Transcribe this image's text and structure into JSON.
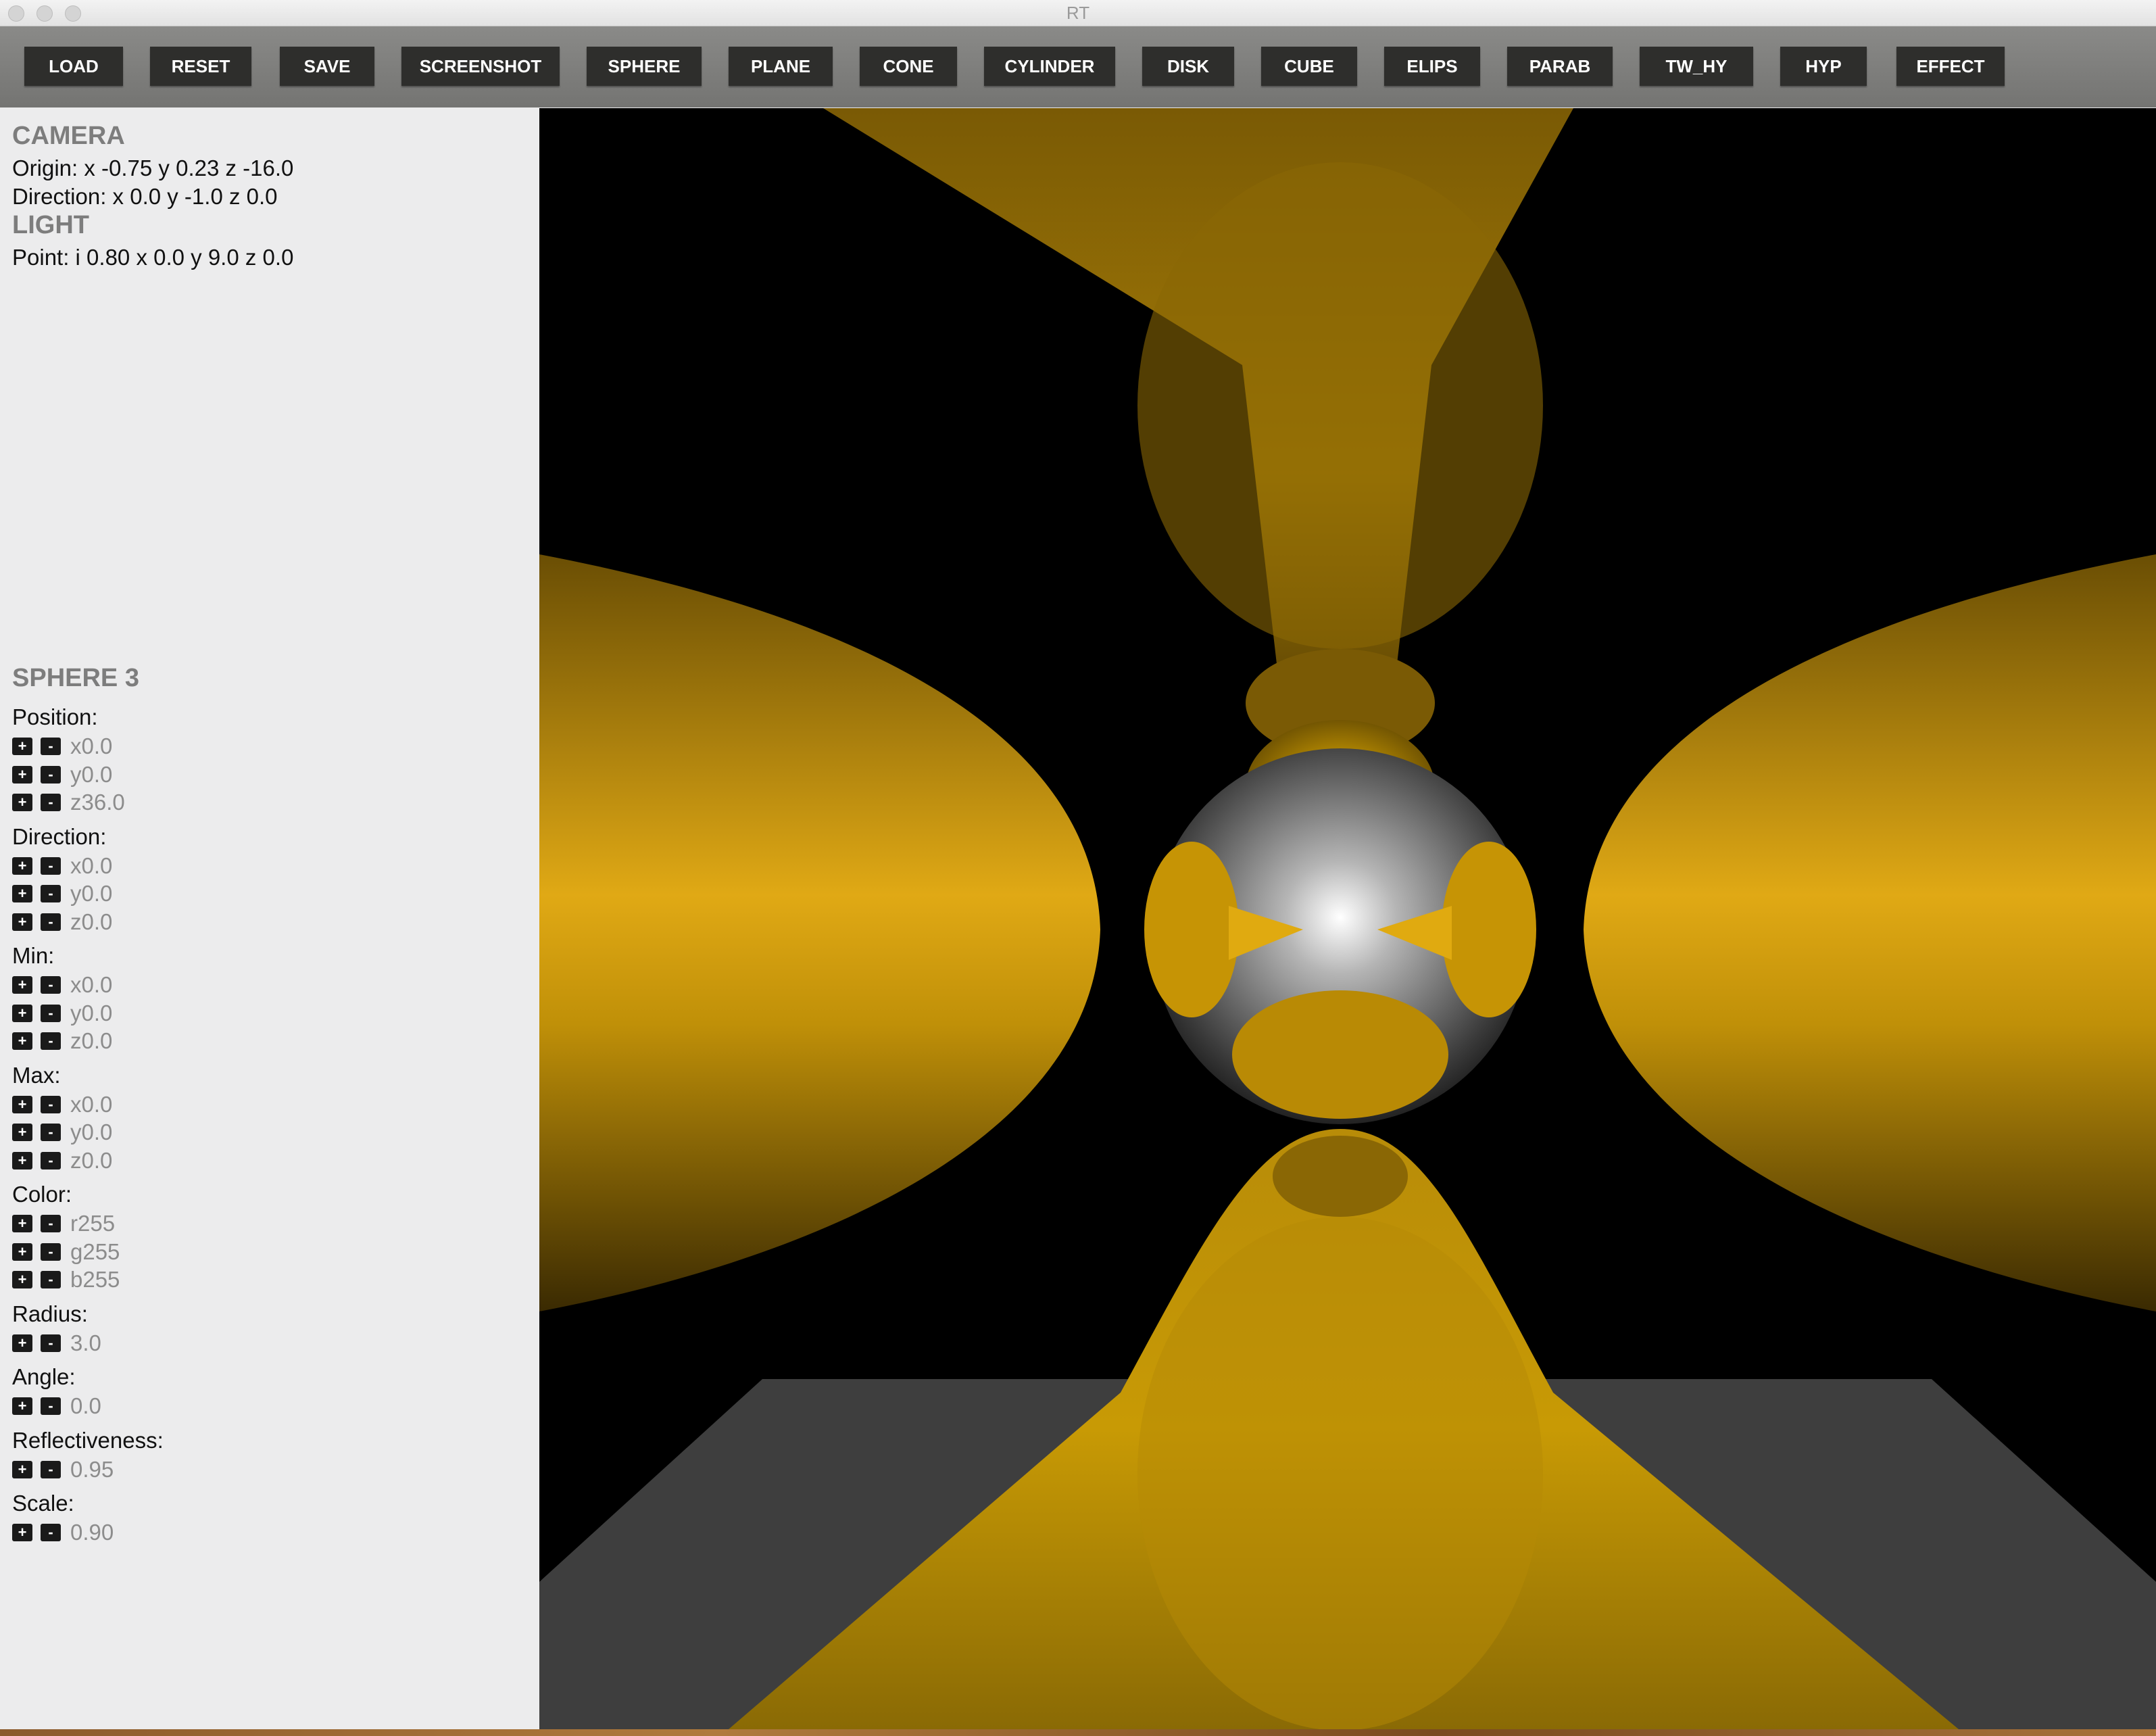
{
  "window": {
    "title": "RT"
  },
  "toolbar": {
    "buttons": [
      {
        "label": "LOAD"
      },
      {
        "label": "RESET"
      },
      {
        "label": "SAVE"
      },
      {
        "label": "SCREENSHOT"
      },
      {
        "label": "SPHERE"
      },
      {
        "label": "PLANE"
      },
      {
        "label": "CONE"
      },
      {
        "label": "CYLINDER"
      },
      {
        "label": "DISK"
      },
      {
        "label": "CUBE"
      },
      {
        "label": "ELIPS"
      },
      {
        "label": "PARAB"
      },
      {
        "label": "TW_HY"
      },
      {
        "label": "HYP"
      },
      {
        "label": "EFFECT"
      }
    ]
  },
  "camera": {
    "heading": "CAMERA",
    "origin": "Origin: x -0.75 y 0.23 z -16.0",
    "direction": "Direction: x 0.0 y -1.0 z 0.0"
  },
  "light": {
    "heading": "LIGHT",
    "point": "Point: i 0.80 x 0.0 y 9.0 z 0.0"
  },
  "object": {
    "heading": "SPHERE 3",
    "plus": "+",
    "minus": "-",
    "groups": [
      {
        "label": "Position:",
        "values": [
          "x0.0",
          "y0.0",
          "z36.0"
        ]
      },
      {
        "label": "Direction:",
        "values": [
          "x0.0",
          "y0.0",
          "z0.0"
        ]
      },
      {
        "label": "Min:",
        "values": [
          "x0.0",
          "y0.0",
          "z0.0"
        ]
      },
      {
        "label": "Max:",
        "values": [
          "x0.0",
          "y0.0",
          "z0.0"
        ]
      },
      {
        "label": "Color:",
        "values": [
          "r255",
          "g255",
          "b255"
        ]
      },
      {
        "label": "Radius:",
        "values": [
          "3.0"
        ]
      },
      {
        "label": "Angle:",
        "values": [
          "0.0"
        ]
      },
      {
        "label": "Reflectiveness:",
        "values": [
          "0.95"
        ]
      },
      {
        "label": "Scale:",
        "values": [
          "0.90"
        ]
      }
    ]
  },
  "colors": {
    "object_yellow": "#d4a017",
    "chrome": "#9a9a9a",
    "toolbar_button": "#2e2e2c"
  }
}
